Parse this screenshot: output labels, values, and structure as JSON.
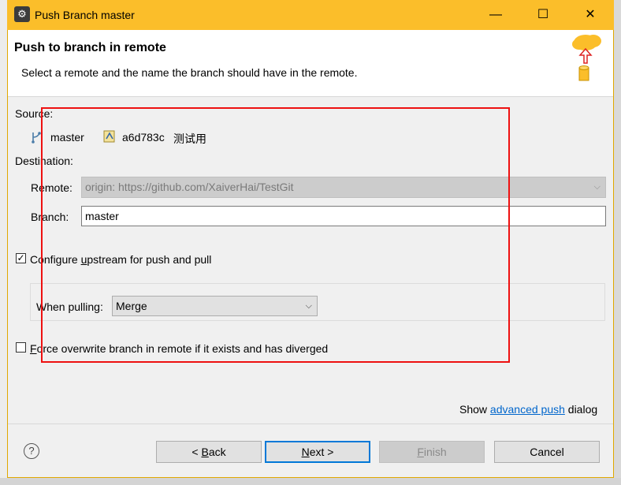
{
  "window": {
    "title": "Push Branch master"
  },
  "header": {
    "title": "Push to branch in remote",
    "description": "Select a remote and the name the branch should have in the remote."
  },
  "source": {
    "label": "Source:",
    "branch": "master",
    "commit_id": "a6d783c",
    "commit_message": "测试用"
  },
  "destination": {
    "label": "Destination:",
    "remote_label": "Remote:",
    "remote_value": "origin: https://github.com/XaiverHai/TestGit",
    "branch_label": "Branch:",
    "branch_value": "master"
  },
  "upstream": {
    "checked": true,
    "label_pre": "Configure ",
    "label_accel": "u",
    "label_post": "pstream for push and pull",
    "when_pulling_label": "When pulling:",
    "when_pulling_value": "Merge"
  },
  "force": {
    "checked": false,
    "label_accel": "F",
    "label_post": "orce overwrite branch in remote if it exists and has diverged"
  },
  "advanced": {
    "pre": "Show ",
    "link": "advanced push",
    "post": " dialog"
  },
  "buttons": {
    "back_pre": "< ",
    "back_accel": "B",
    "back_post": "ack",
    "next_accel": "N",
    "next_post": "ext >",
    "finish_accel": "F",
    "finish_post": "inish",
    "cancel": "Cancel"
  },
  "colors": {
    "titlebar": "#fbbe2a",
    "annotation_box": "#e11111",
    "link": "#0066cc",
    "default_button_border": "#0078d7"
  }
}
